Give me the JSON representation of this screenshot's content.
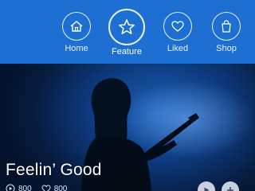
{
  "nav": {
    "items": [
      {
        "label": "Home",
        "icon": "home-icon"
      },
      {
        "label": "Feature",
        "icon": "star-icon",
        "active": true
      },
      {
        "label": "Liked",
        "icon": "heart-icon"
      },
      {
        "label": "Shop",
        "icon": "shopping-bag-icon"
      }
    ],
    "accent": "#1e6fd2"
  },
  "hero": {
    "title": "Feelin’ Good",
    "plays": "800",
    "likes": "800"
  }
}
